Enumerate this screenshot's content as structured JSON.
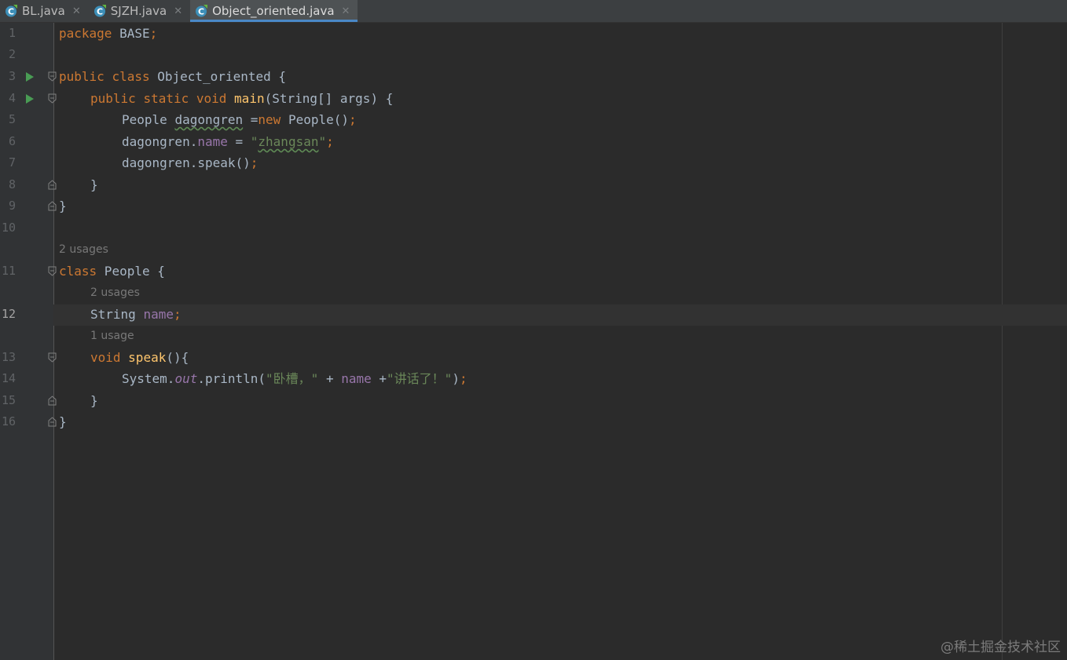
{
  "tabs": [
    {
      "label": "BL.java",
      "active": false
    },
    {
      "label": "SJZH.java",
      "active": false
    },
    {
      "label": "Object_oriented.java",
      "active": true
    }
  ],
  "line_numbers": [
    "1",
    "2",
    "3",
    "4",
    "5",
    "6",
    "7",
    "8",
    "9",
    "10",
    "11",
    "12",
    "13",
    "14",
    "15",
    "16"
  ],
  "code": {
    "l1_kw": "package",
    "l1_rest": " BASE",
    "l1_semi": ";",
    "l3_kw1": "public",
    "l3_kw2": "class",
    "l3_rest": " Object_oriented {",
    "l4_kw1": "public",
    "l4_kw2": "static",
    "l4_kw3": "void",
    "l4_fn": "main",
    "l4_rest": "(String[] args) {",
    "l5_type": "People ",
    "l5_var": "dagongren",
    "l5_eq": " =",
    "l5_new": "new",
    "l5_ctor": " People()",
    "l5_semi": ";",
    "l6_obj": "dagongren.",
    "l6_fld": "name",
    "l6_eq": " = ",
    "l6_q1": "\"",
    "l6_str": "zhangsan",
    "l6_q2": "\"",
    "l6_semi": ";",
    "l7_call": "dagongren.speak()",
    "l7_semi": ";",
    "l8_brace": "}",
    "l9_brace": "}",
    "l11_kw": "class",
    "l11_rest": " People {",
    "l12_type": "String ",
    "l12_fld": "name",
    "l12_semi": ";",
    "l13_kw": "void",
    "l13_fn": "speak",
    "l13_rest": "(){",
    "l14_sys": "System.",
    "l14_out": "out",
    "l14_call": ".println(",
    "l14_str1": "\"卧槽，\"",
    "l14_plus1": " + ",
    "l14_fld": "name",
    "l14_plus2": " +",
    "l14_str2": "\"讲话了！\"",
    "l14_end": ")",
    "l14_semi": ";",
    "l15_brace": "}",
    "l16_brace": "}"
  },
  "hints": {
    "class_people": "2 usages",
    "field_name": "2 usages",
    "method_speak": "1 usage"
  },
  "watermark": "@稀土掘金技术社区",
  "colors": {
    "keyword": "#cc7832",
    "function": "#ffc66d",
    "field": "#9876aa",
    "string": "#6a8759",
    "text": "#a9b7c6",
    "run_icon": "#499c54"
  }
}
